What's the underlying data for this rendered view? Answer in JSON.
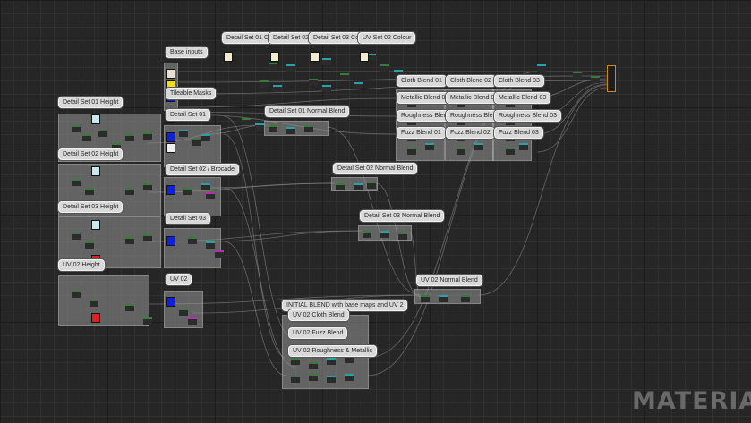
{
  "graph": {
    "comments": {
      "detail_set_01_height": "Detail Set 01 Height",
      "detail_set_02_height": "Detail Set 02 Height",
      "detail_set_03_height": "Detail Set 03 Height",
      "uv_02_height": "UV 02 Height",
      "base_inputs": "Base inputs",
      "tileable_masks": "Tileable Masks",
      "detail_set_01": "Detail Set 01",
      "detail_set_02_brocade": "Detail Set 02 / Brocade",
      "detail_set_03": "Detail Set 03",
      "uv_02": "UV 02",
      "detail_set_01_colour": "Detail Set 01 Colour",
      "detail_set_02_colour": "Detail Set 02 Colour",
      "detail_set_03_colour": "Detail Set 03 Colour",
      "uv_set_02_colour": "UV Set 02 Colour",
      "detail_set_01_normal_blend": "Detail Set 01 Normal Blend",
      "detail_set_02_normal_blend": "Detail Set 02 Normal Blend",
      "detail_set_03_normal_blend": "Detail Set 03 Normal Blend",
      "uv_02_normal_blend": "UV 02 Normal Blend",
      "initial_blend": "INITIAL BLEND with base maps and UV 2",
      "uv_02_cloth_blend": "UV 02 Cloth Blend",
      "uv_02_fuzz_blend": "UV 02 Fuzz Blend",
      "uv_02_roughness_metallic": "UV 02 Roughness & Metallic",
      "cloth_blend_01": "Cloth Blend 01",
      "cloth_blend_02": "Cloth Blend 02",
      "cloth_blend_03": "Cloth Blend 03",
      "metallic_blend_01": "Metallic Blend 01",
      "metallic_blend_02": "Metallic Blend 02",
      "metallic_blend_03": "Metallic Blend 03",
      "roughness_blend_01": "Roughness Blend 01",
      "roughness_blend_02": "Roughness Blend 02",
      "roughness_blend_03": "Roughness Blend 03",
      "fuzz_blend_01": "Fuzz Blend 01",
      "fuzz_blend_02": "Fuzz Blend 02",
      "fuzz_blend_03": "Fuzz Blend 03"
    },
    "watermark": "MATERIAL",
    "colors": {
      "output_border": "#d08a10",
      "wire": "#9a9a9a"
    }
  }
}
